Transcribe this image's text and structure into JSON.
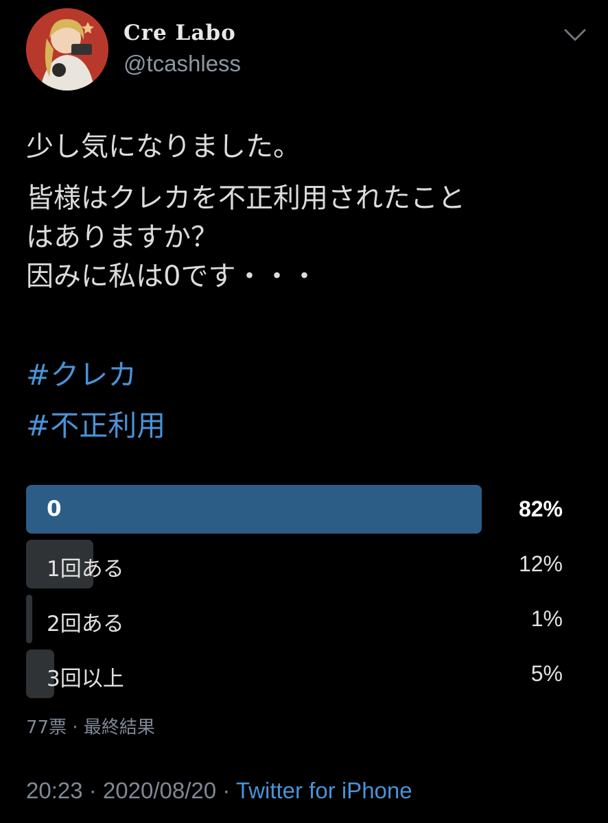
{
  "author": {
    "display_name": "Cre Labo",
    "handle": "@tcashless",
    "avatar_icon": "avatar-image"
  },
  "tweet": {
    "line1": "少し気になりました。",
    "line2": "皆様はクレカを不正利用されたこと",
    "line3": "はありますか？",
    "line4": "因みに私は0です・・・",
    "hashtags": [
      "#クレカ",
      "#不正利用"
    ]
  },
  "poll": {
    "options": [
      {
        "label": "0",
        "percent_text": "82%",
        "fill": 0.85,
        "winner": true
      },
      {
        "label": "1回ある",
        "percent_text": "12%",
        "fill": 0.125,
        "winner": false
      },
      {
        "label": "2回ある",
        "percent_text": "1%",
        "fill": 0.011,
        "winner": false
      },
      {
        "label": "3回以上",
        "percent_text": "5%",
        "fill": 0.052,
        "winner": false
      }
    ],
    "summary": "77票 · 最終結果"
  },
  "meta": {
    "time": "20:23",
    "separator": " · ",
    "date": "2020/08/20",
    "source": "Twitter for iPhone"
  },
  "colors": {
    "background": "#000000",
    "winner_bar": "#2c5d86",
    "loser_bar": "#2f3336",
    "link": "#4a93d6",
    "muted": "#7e8a96"
  }
}
